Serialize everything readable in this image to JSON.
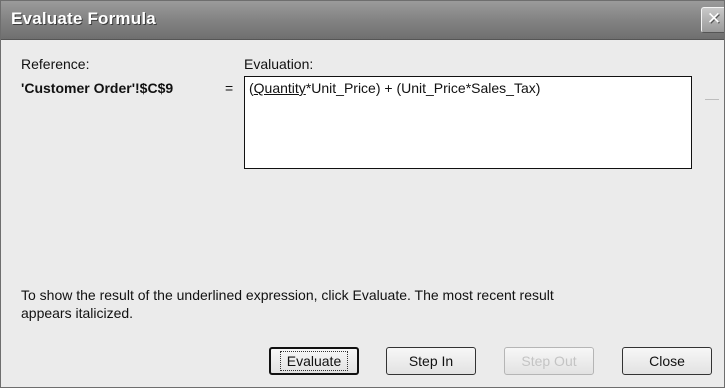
{
  "window": {
    "title": "Evaluate Formula",
    "close_glyph": "✕"
  },
  "reference": {
    "label": "Reference:",
    "value": "'Customer Order'!$C$9",
    "equals": "="
  },
  "evaluation": {
    "label": "Evaluation:",
    "open_paren": "(",
    "underlined_part": "Quantity",
    "rest": "*Unit_Price) + (Unit_Price*Sales_Tax)"
  },
  "hint": {
    "line1": "To show the result of the underlined expression, click Evaluate.  The most recent result",
    "line2": "appears italicized."
  },
  "buttons": {
    "evaluate": "Evaluate",
    "step_in": "Step In",
    "step_out": "Step Out",
    "close": "Close"
  },
  "colors": {
    "titlebar": "#858585",
    "dialog_bg": "#ebebeb",
    "disabled_text": "#c4c4c4"
  }
}
